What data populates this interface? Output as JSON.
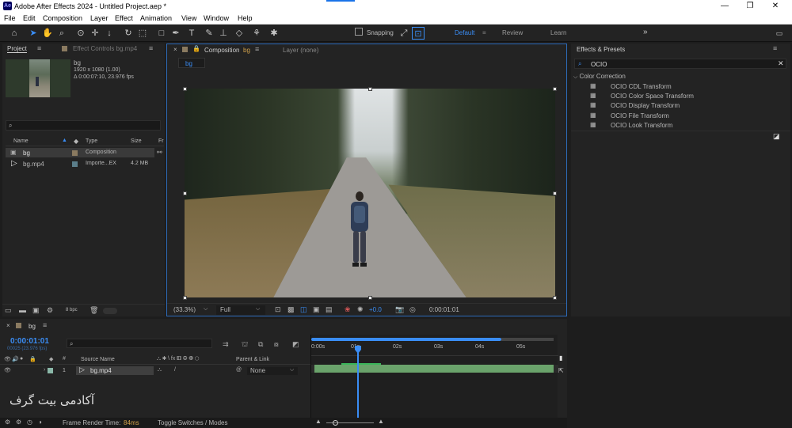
{
  "window": {
    "title": "Adobe After Effects 2024 - Untitled Project.aep *",
    "logo_text": "Ae"
  },
  "menu": [
    "File",
    "Edit",
    "Composition",
    "Layer",
    "Effect",
    "Animation",
    "View",
    "Window",
    "Help"
  ],
  "toolbar": {
    "snapping_label": "Snapping",
    "workspaces": [
      "Default",
      "Review",
      "Learn"
    ]
  },
  "project_panel": {
    "tab_project": "Project",
    "tab_effect_controls": "Effect Controls bg.mp4",
    "selected_name": "bg",
    "selected_info1": "1920 x 1080 (1.00)",
    "selected_info2": "Δ 0:00:07:10, 23.976 fps",
    "search_icon": "search-icon",
    "columns": [
      "Name",
      "Type",
      "Size",
      "Fr"
    ],
    "rows": [
      {
        "name": "bg",
        "type": "Composition",
        "size": ""
      },
      {
        "name": "bg.mp4",
        "type": "Importe...EX",
        "size": "4.2 MB"
      }
    ],
    "bpc": "8 bpc"
  },
  "comp_panel": {
    "tab_composition": "Composition",
    "tab_comp_name": "bg",
    "tab_layer": "Layer (none)",
    "breadcrumb": "bg",
    "zoom": "(33.3%)",
    "resolution": "Full",
    "exposure": "+0.0",
    "timecode": "0:00:01:01"
  },
  "effects_panel": {
    "title": "Effects & Presets",
    "search_value": "OCIO",
    "category": "Color Correction",
    "items": [
      "OCIO CDL Transform",
      "OCIO Color Space Transform",
      "OCIO Display Transform",
      "OCIO File Transform",
      "OCIO Look Transform"
    ]
  },
  "timeline": {
    "tab_name": "bg",
    "current_time": "0:00:01:01",
    "frames": "00025 (23.976 fps)",
    "source_name_header": "Source Name",
    "parent_header": "Parent & Link",
    "layer_number": "1",
    "layer_name": "bg.mp4",
    "parent_value": "None",
    "ruler_labels": [
      "0:00s",
      "01s",
      "02s",
      "03s",
      "04s",
      "05s"
    ],
    "footer_render_label": "Frame Render Time:",
    "footer_render_value": "84ms",
    "footer_toggle": "Toggle Switches / Modes"
  },
  "watermark": "آکادمی بیت گرف"
}
